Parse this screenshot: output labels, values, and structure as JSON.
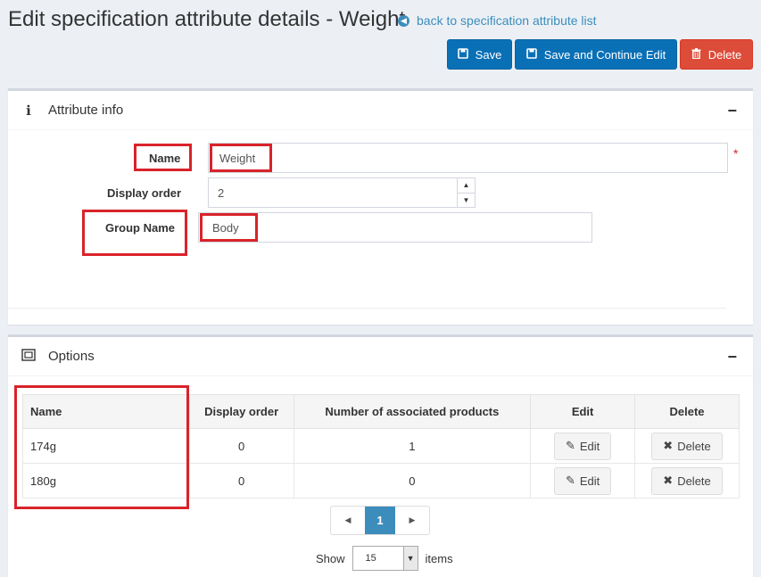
{
  "header": {
    "title": "Edit specification attribute details - Weight",
    "back_link": "back to specification attribute list"
  },
  "toolbar": {
    "save_label": "Save",
    "save_continue_label": "Save and Continue Edit",
    "delete_label": "Delete"
  },
  "attribute_info": {
    "title": "Attribute info",
    "collapse_glyph": "−",
    "name_label": "Name",
    "name_value": "Weight",
    "required_mark": "*",
    "display_order_label": "Display order",
    "display_order_value": "2",
    "group_name_label": "Group Name",
    "group_name_value": "Body"
  },
  "options": {
    "title": "Options",
    "collapse_glyph": "−",
    "columns": [
      "Name",
      "Display order",
      "Number of associated products",
      "Edit",
      "Delete"
    ],
    "rows": [
      {
        "name": "174g",
        "display_order": "0",
        "associated": "1",
        "edit": "Edit",
        "delete": "Delete"
      },
      {
        "name": "180g",
        "display_order": "0",
        "associated": "0",
        "edit": "Edit",
        "delete": "Delete"
      }
    ],
    "pager": {
      "prev": "◀",
      "current": "1",
      "next": "▶"
    },
    "show_label": "Show",
    "page_size": "15",
    "items_label": "items"
  },
  "colors": {
    "primary": "#0a70b6",
    "danger": "#dd4b39",
    "highlight": "#d9232a",
    "link": "#3c8dbc"
  }
}
